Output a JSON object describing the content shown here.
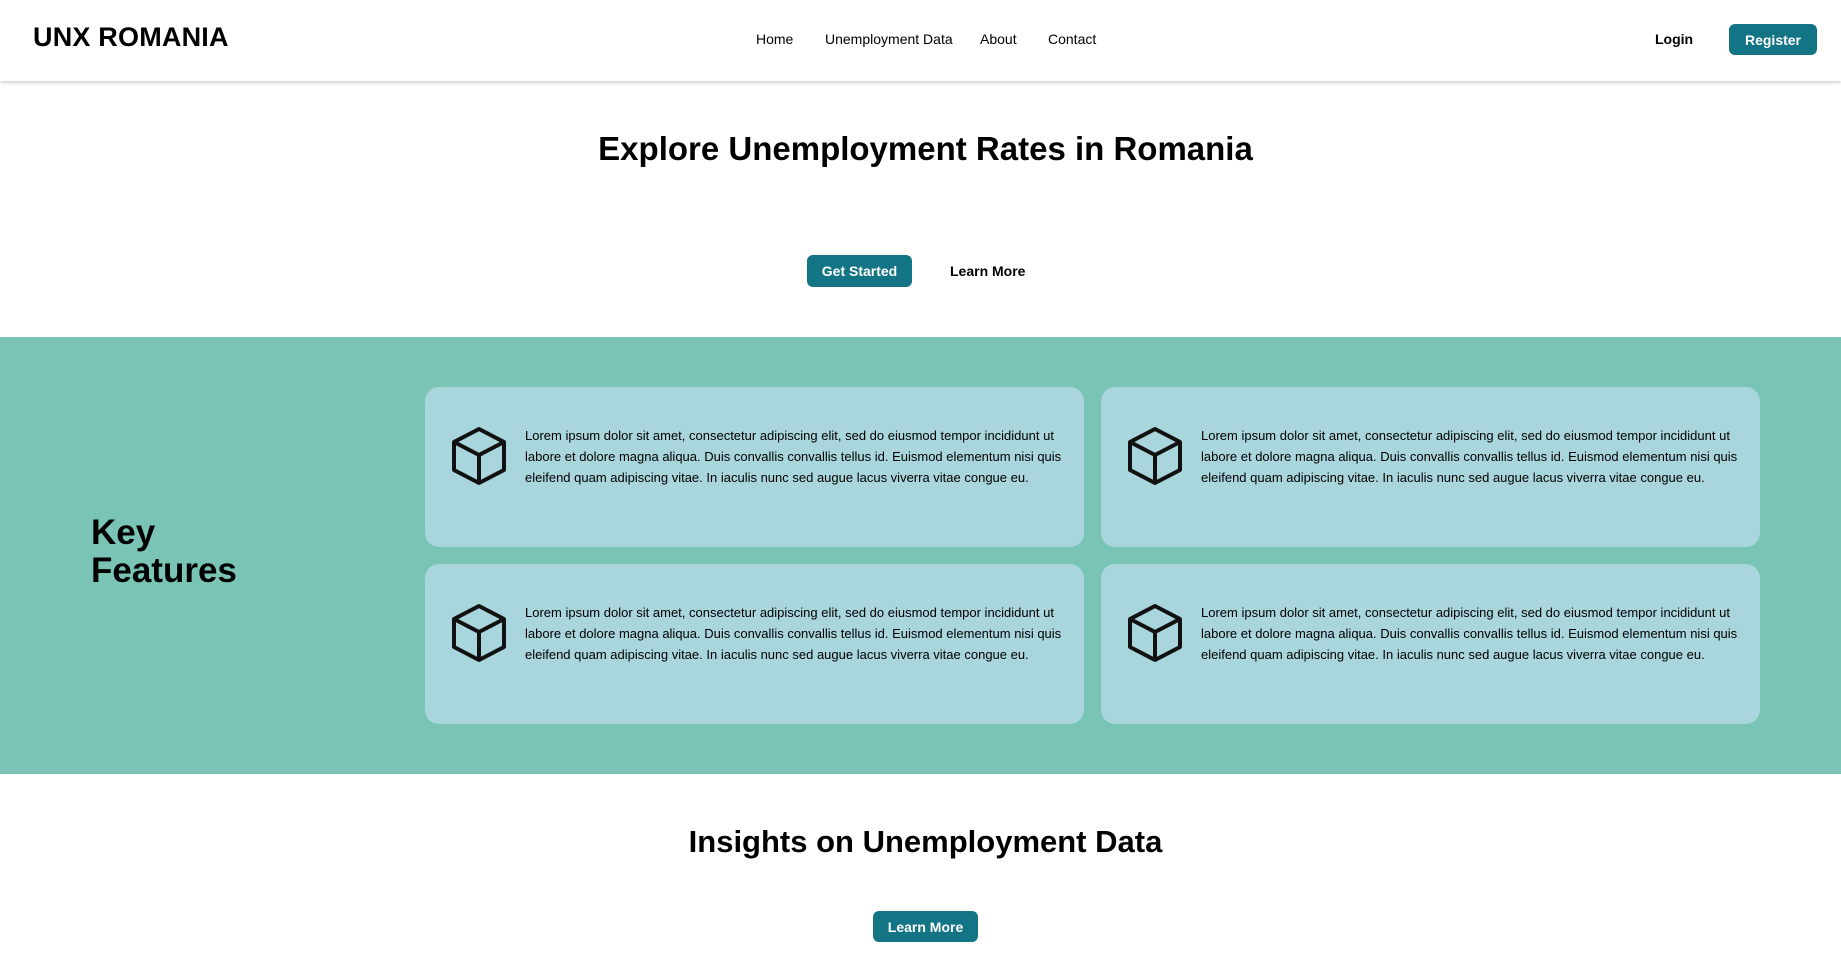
{
  "header": {
    "logo": "UNX ROMANIA",
    "nav": [
      "Home",
      "Unemployment Data",
      "About",
      "Contact"
    ],
    "login_label": "Login",
    "register_label": "Register"
  },
  "hero": {
    "title": "Explore Unemployment Rates in Romania",
    "get_started_label": "Get Started",
    "learn_more_label": "Learn More"
  },
  "features": {
    "title": "Key Features",
    "background_color": "#7ac4b6",
    "card_color": "#a9d5dc",
    "cards": [
      {
        "icon": "cube-icon",
        "text": "Lorem ipsum dolor sit amet, consectetur adipiscing elit, sed do eiusmod tempor incididunt ut labore et dolore magna aliqua. Duis convallis convallis tellus id. Euismod elementum nisi quis eleifend quam adipiscing vitae. In iaculis nunc sed augue lacus viverra vitae congue eu."
      },
      {
        "icon": "cube-icon",
        "text": "Lorem ipsum dolor sit amet, consectetur adipiscing elit, sed do eiusmod tempor incididunt ut labore et dolore magna aliqua. Duis convallis convallis tellus id. Euismod elementum nisi quis eleifend quam adipiscing vitae. In iaculis nunc sed augue lacus viverra vitae congue eu."
      },
      {
        "icon": "cube-icon",
        "text": "Lorem ipsum dolor sit amet, consectetur adipiscing elit, sed do eiusmod tempor incididunt ut labore et dolore magna aliqua. Duis convallis convallis tellus id. Euismod elementum nisi quis eleifend quam adipiscing vitae. In iaculis nunc sed augue lacus viverra vitae congue eu."
      },
      {
        "icon": "cube-icon",
        "text": "Lorem ipsum dolor sit amet, consectetur adipiscing elit, sed do eiusmod tempor incididunt ut labore et dolore magna aliqua. Duis convallis convallis tellus id. Euismod elementum nisi quis eleifend quam adipiscing vitae. In iaculis nunc sed augue lacus viverra vitae congue eu."
      }
    ]
  },
  "insights": {
    "title": "Insights on Unemployment Data",
    "learn_more_label": "Learn More"
  },
  "colors": {
    "accent": "#137486"
  }
}
